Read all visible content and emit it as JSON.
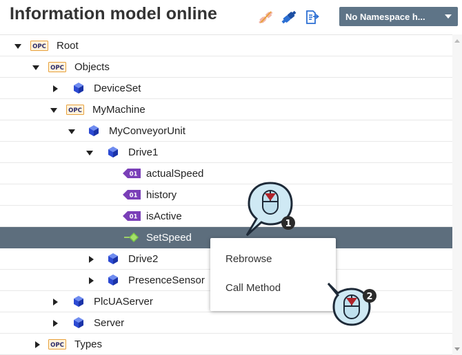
{
  "header": {
    "title": "Information model online",
    "namespace_select": "No Namespace h...",
    "icons": [
      "disconnect-icon",
      "connect-icon",
      "export-icon"
    ]
  },
  "tree": {
    "rows": [
      {
        "label": "Root",
        "icon": "opc-folder-icon",
        "toggle": "open",
        "level": 0
      },
      {
        "label": "Objects",
        "icon": "opc-folder-icon",
        "toggle": "open",
        "level": 1
      },
      {
        "label": "DeviceSet",
        "icon": "object-cube-icon",
        "toggle": "closed",
        "level": 2
      },
      {
        "label": "MyMachine",
        "icon": "opc-folder-icon",
        "toggle": "open",
        "level": 2
      },
      {
        "label": "MyConveyorUnit",
        "icon": "object-cube-icon",
        "toggle": "open",
        "level": 3
      },
      {
        "label": "Drive1",
        "icon": "object-cube-icon",
        "toggle": "open",
        "level": 4
      },
      {
        "label": "actualSpeed",
        "icon": "variable-icon",
        "toggle": "none",
        "level": 5
      },
      {
        "label": "history",
        "icon": "variable-icon",
        "toggle": "none",
        "level": 5
      },
      {
        "label": "isActive",
        "icon": "variable-icon",
        "toggle": "none",
        "level": 5
      },
      {
        "label": "SetSpeed",
        "icon": "method-icon",
        "toggle": "none",
        "level": 5,
        "selected": true
      },
      {
        "label": "Drive2",
        "icon": "object-cube-icon",
        "toggle": "closed",
        "level": 4
      },
      {
        "label": "PresenceSensor",
        "icon": "object-cube-icon",
        "toggle": "closed",
        "level": 4
      },
      {
        "label": "PlcUAServer",
        "icon": "object-cube-icon",
        "toggle": "closed",
        "level": 2
      },
      {
        "label": "Server",
        "icon": "object-cube-icon",
        "toggle": "closed",
        "level": 2
      },
      {
        "label": "Types",
        "icon": "opc-folder-icon",
        "toggle": "closed",
        "level": 1
      }
    ]
  },
  "context_menu": {
    "items": [
      "Rebrowse",
      "Call Method"
    ]
  },
  "callouts": {
    "step1": "1",
    "step2": "2"
  },
  "icon_text": {
    "opc": "OPC",
    "var": "01"
  },
  "colors": {
    "selected_row": "#5d6e7d",
    "namespace_button": "#5e7487",
    "object_cube": "#2c4ad3",
    "variable": "#7a3fb8",
    "method": "#7ac943",
    "opc_folder": "#e8a03a"
  }
}
